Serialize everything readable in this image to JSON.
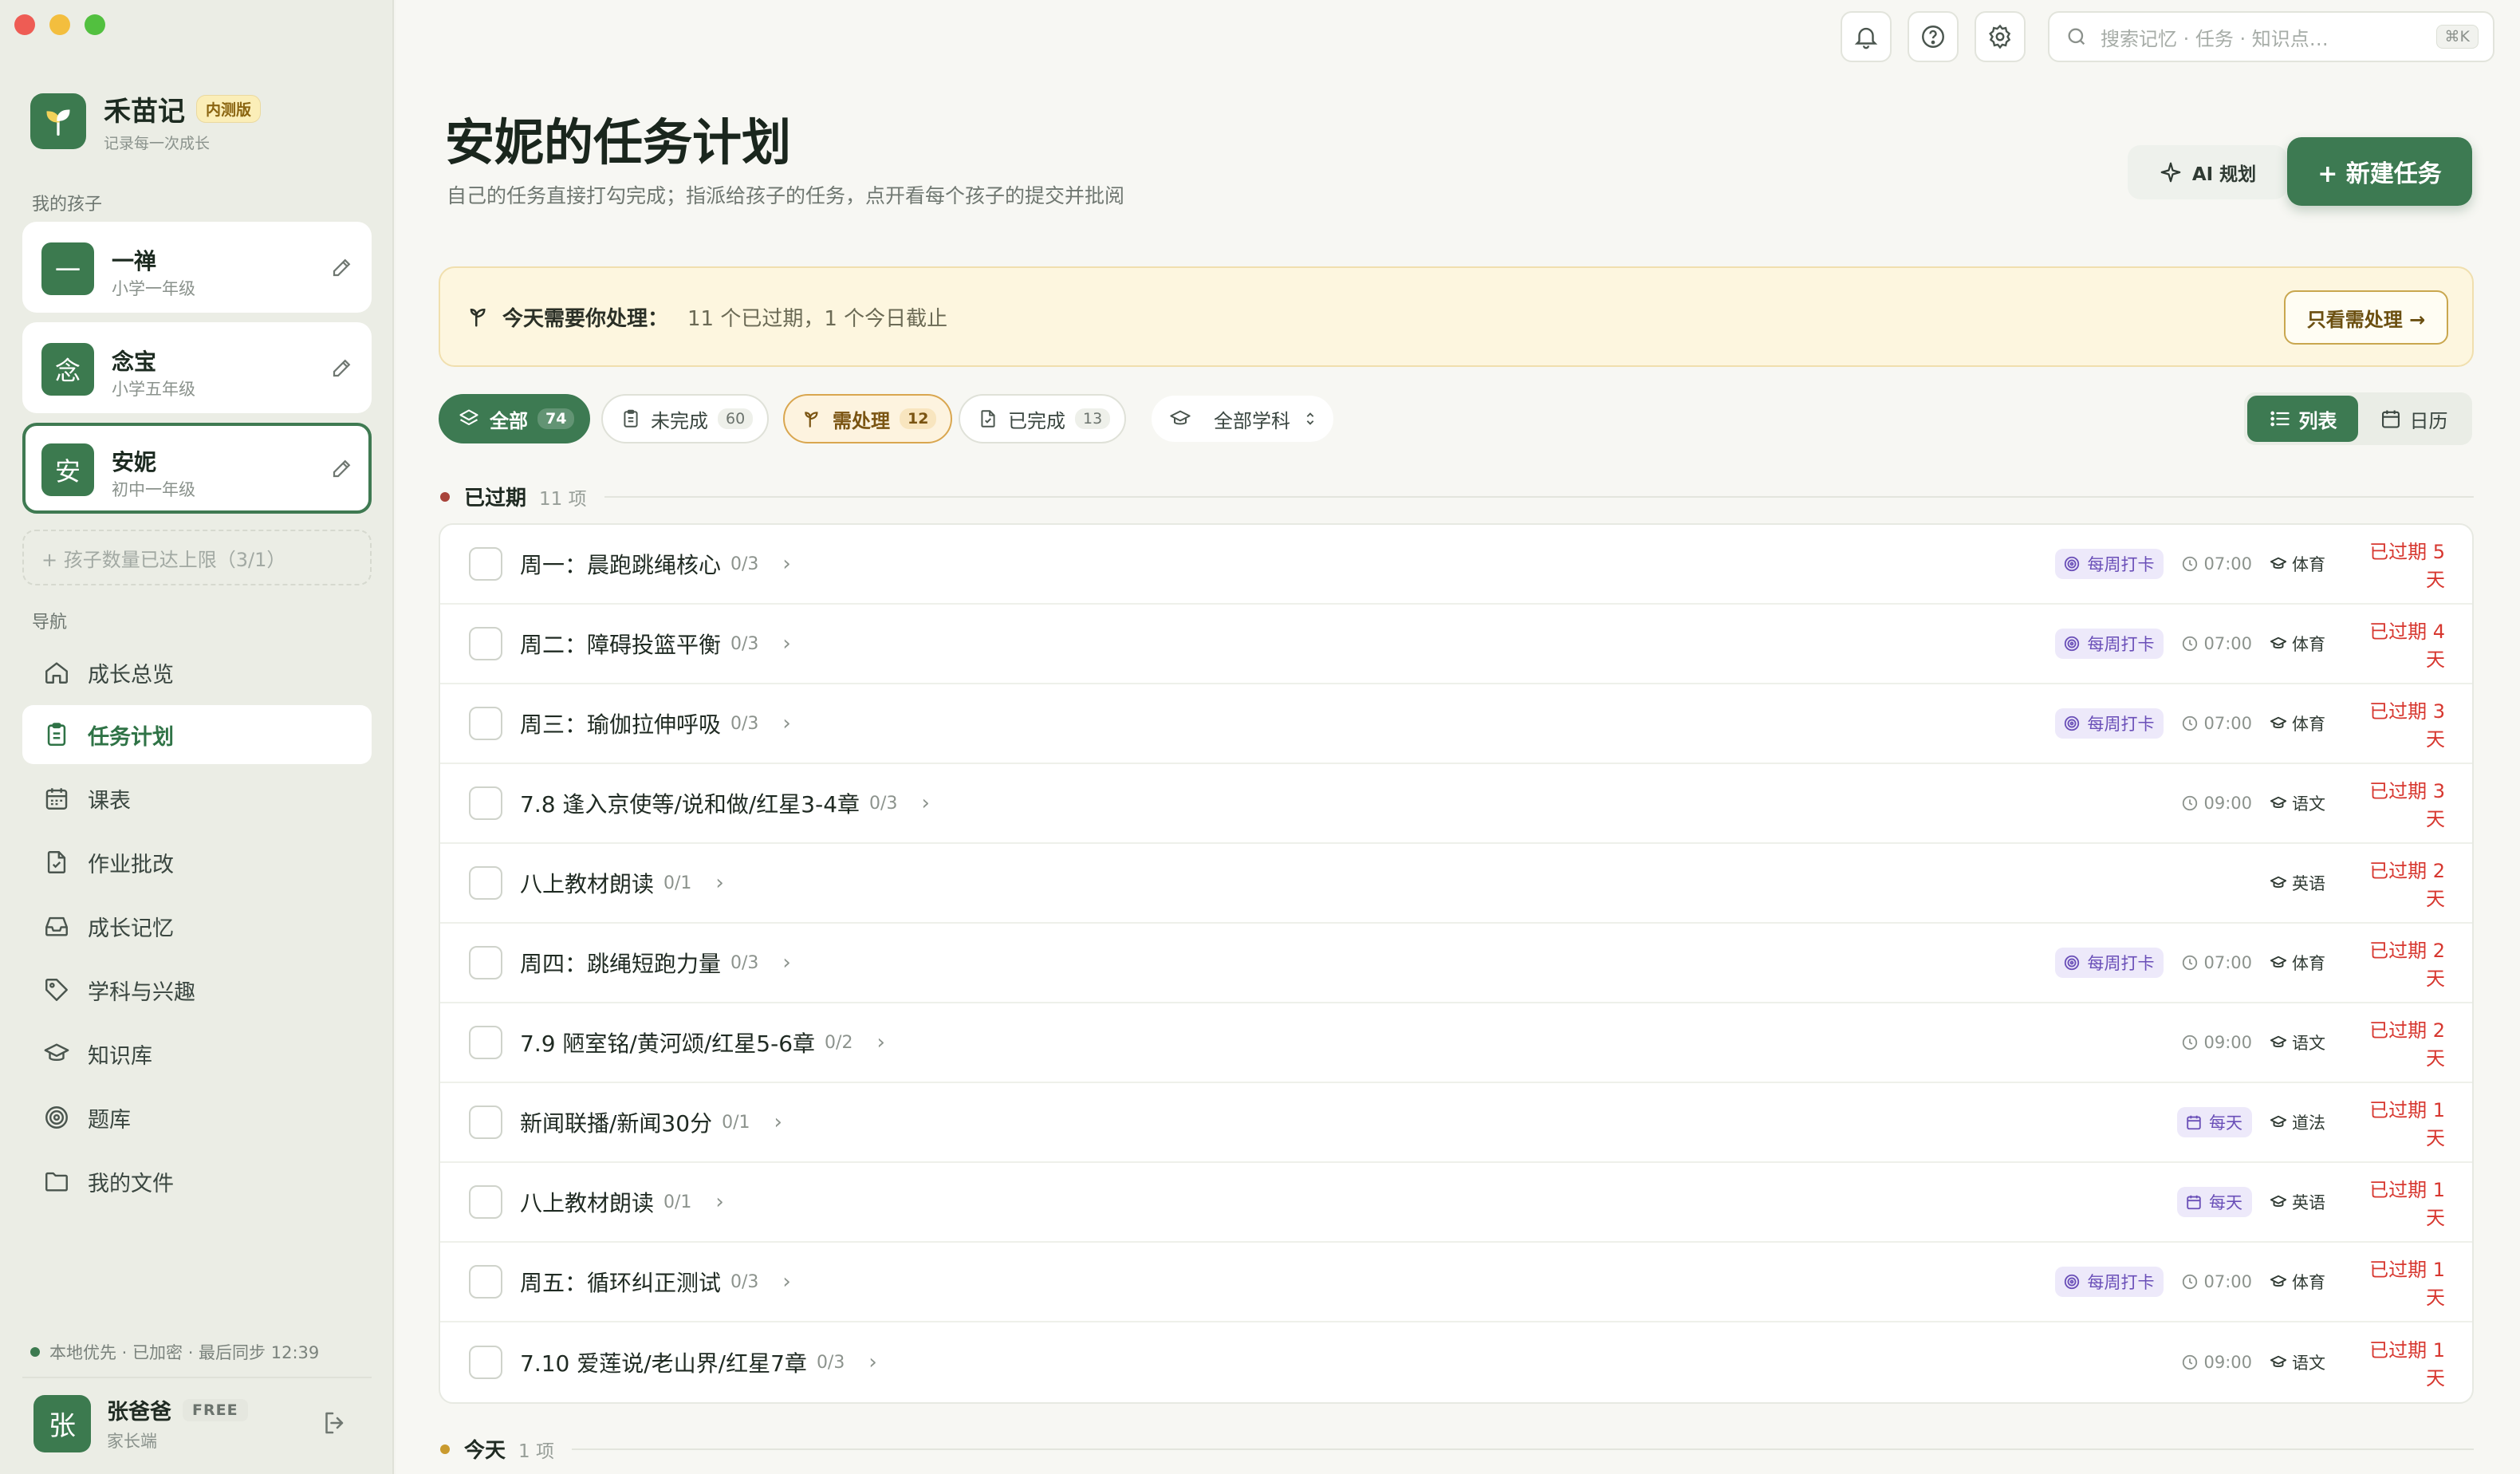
{
  "app": {
    "name": "禾苗记",
    "badge": "内测版",
    "tagline": "记录每一次成长"
  },
  "sidebar": {
    "children_heading": "我的孩子",
    "children": [
      {
        "avatar": "一",
        "name": "一禅",
        "grade": "小学一年级"
      },
      {
        "avatar": "念",
        "name": "念宝",
        "grade": "小学五年级"
      },
      {
        "avatar": "安",
        "name": "安妮",
        "grade": "初中一年级"
      }
    ],
    "child_limit_text": "+ 孩子数量已达上限（3/1）",
    "nav_heading": "导航",
    "nav": [
      {
        "label": "成长总览",
        "icon": "home-icon"
      },
      {
        "label": "任务计划",
        "icon": "clipboard-icon"
      },
      {
        "label": "课表",
        "icon": "calendar-icon"
      },
      {
        "label": "作业批改",
        "icon": "file-check-icon"
      },
      {
        "label": "成长记忆",
        "icon": "inbox-icon"
      },
      {
        "label": "学科与兴趣",
        "icon": "tag-icon"
      },
      {
        "label": "知识库",
        "icon": "graduation-cap-icon"
      },
      {
        "label": "题库",
        "icon": "target-icon"
      },
      {
        "label": "我的文件",
        "icon": "folder-icon"
      }
    ],
    "sync_status": "本地优先 · 已加密 · 最后同步 12:39",
    "user": {
      "avatar": "张",
      "name": "张爸爸",
      "plan": "FREE",
      "role": "家长端"
    }
  },
  "topbar": {
    "search_placeholder": "搜索记忆 · 任务 · 知识点…",
    "search_shortcut": "⌘K"
  },
  "header": {
    "title": "安妮的任务计划",
    "subtitle": "自己的任务直接打勾完成；指派给孩子的任务，点开看每个孩子的提交并批阅",
    "ai_button": "AI 规划",
    "new_button": "+ 新建任务"
  },
  "alert": {
    "title": "今天需要你处理：",
    "text": "11 个已过期，1 个今日截止",
    "button": "只看需处理 →"
  },
  "filters": [
    {
      "label": "全部",
      "count": "74"
    },
    {
      "label": "未完成",
      "count": "60"
    },
    {
      "label": "需处理",
      "count": "12"
    },
    {
      "label": "已完成",
      "count": "13"
    }
  ],
  "subject_filter": "全部学科",
  "views": {
    "list": "列表",
    "calendar": "日历"
  },
  "groups": {
    "overdue": {
      "name": "已过期",
      "count": "11 项",
      "color": "#a8433a"
    },
    "today": {
      "name": "今天",
      "count": "1 项",
      "color": "#c99a2e"
    }
  },
  "tasks": [
    {
      "title": "周一：晨跑跳绳核心",
      "progress": "0/3",
      "tag": "每周打卡",
      "tag_icon": "target-icon",
      "time": "07:00",
      "subject": "体育",
      "status": "已过期 5 天"
    },
    {
      "title": "周二：障碍投篮平衡",
      "progress": "0/3",
      "tag": "每周打卡",
      "tag_icon": "target-icon",
      "time": "07:00",
      "subject": "体育",
      "status": "已过期 4 天"
    },
    {
      "title": "周三：瑜伽拉伸呼吸",
      "progress": "0/3",
      "tag": "每周打卡",
      "tag_icon": "target-icon",
      "time": "07:00",
      "subject": "体育",
      "status": "已过期 3 天"
    },
    {
      "title": "7.8 逢入京使等/说和做/红星3-4章",
      "progress": "0/3",
      "tag": "",
      "tag_icon": "",
      "time": "09:00",
      "subject": "语文",
      "status": "已过期 3 天"
    },
    {
      "title": "八上教材朗读",
      "progress": "0/1",
      "tag": "",
      "tag_icon": "",
      "time": "",
      "subject": "英语",
      "status": "已过期 2 天"
    },
    {
      "title": "周四：跳绳短跑力量",
      "progress": "0/3",
      "tag": "每周打卡",
      "tag_icon": "target-icon",
      "time": "07:00",
      "subject": "体育",
      "status": "已过期 2 天"
    },
    {
      "title": "7.9 陋室铭/黄河颂/红星5-6章",
      "progress": "0/2",
      "tag": "",
      "tag_icon": "",
      "time": "09:00",
      "subject": "语文",
      "status": "已过期 2 天"
    },
    {
      "title": "新闻联播/新闻30分",
      "progress": "0/1",
      "tag": "每天",
      "tag_icon": "calendar-icon",
      "time": "",
      "subject": "道法",
      "status": "已过期 1 天"
    },
    {
      "title": "八上教材朗读",
      "progress": "0/1",
      "tag": "每天",
      "tag_icon": "calendar-icon",
      "time": "",
      "subject": "英语",
      "status": "已过期 1 天"
    },
    {
      "title": "周五：循环纠正测试",
      "progress": "0/3",
      "tag": "每周打卡",
      "tag_icon": "target-icon",
      "time": "07:00",
      "subject": "体育",
      "status": "已过期 1 天"
    },
    {
      "title": "7.10 爱莲说/老山界/红星7章",
      "progress": "0/3",
      "tag": "",
      "tag_icon": "",
      "time": "09:00",
      "subject": "语文",
      "status": "已过期 1 天"
    }
  ]
}
